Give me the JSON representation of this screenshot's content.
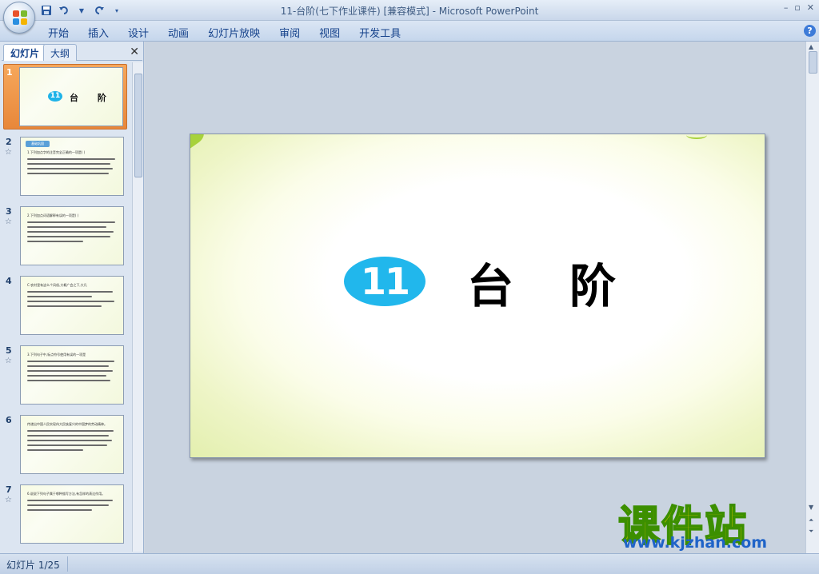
{
  "window": {
    "title": "11-台阶(七下作业课件) [兼容模式] - Microsoft PowerPoint",
    "controls": [
      "–",
      "▫",
      "✕"
    ]
  },
  "qat": {
    "save_icon": "save-icon",
    "undo_icon": "undo-icon",
    "redo_icon": "redo-icon"
  },
  "ribbon": {
    "tabs": [
      "开始",
      "插入",
      "设计",
      "动画",
      "幻灯片放映",
      "审阅",
      "视图",
      "开发工具"
    ],
    "help_label": "?"
  },
  "left_pane": {
    "tab_slides": "幻灯片",
    "tab_outline": "大纲",
    "close_label": "✕",
    "thumbnails": [
      {
        "num": "1",
        "badge": "11",
        "title": "台 阶",
        "selected": true
      },
      {
        "num": "2",
        "star": "☆",
        "heading": "基础巩固",
        "line": "1.下列加点字的注音完全正确的一项是(    )"
      },
      {
        "num": "3",
        "star": "☆",
        "line": "2.下列加点词语解释有误的一项是(    )"
      },
      {
        "num": "4",
        "star": "",
        "line": "C.农村里有这么个风俗,大概广会之下,大凡"
      },
      {
        "num": "5",
        "star": "☆",
        "line": "3.下列句子中,标点符号使用有误的一项是"
      },
      {
        "num": "6",
        "star": "",
        "line": "传递出中国人民实现伟大民族复兴的中国梦的劳动精神。"
      },
      {
        "num": "7",
        "star": "☆",
        "line": "6.说说下列句子属于哪种描写方法,有怎样的表达作用。"
      }
    ]
  },
  "slide": {
    "badge": "11",
    "title": "台阶"
  },
  "watermark": {
    "name": "课件站",
    "url": "www.kjzhan.com"
  },
  "status": {
    "slide_counter": "幻灯片 1/25"
  }
}
